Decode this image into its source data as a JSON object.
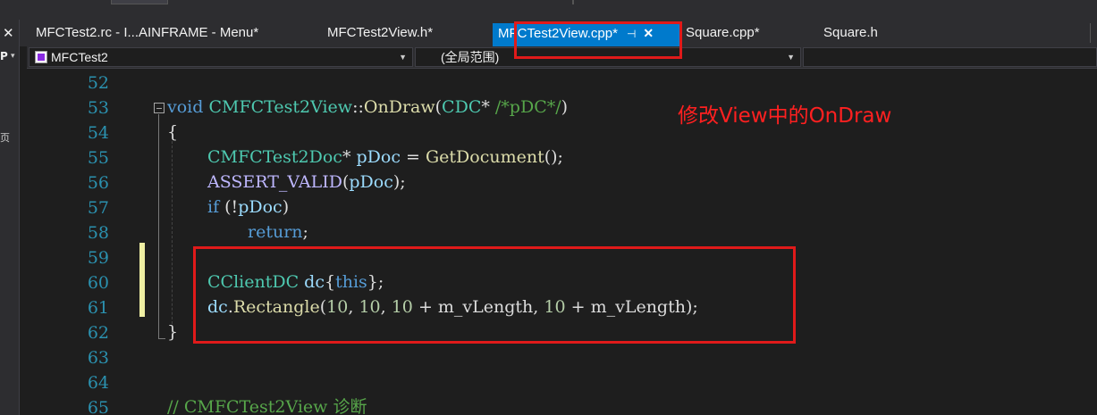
{
  "tabs": [
    {
      "label": "MFCTest2.rc - I...AINFRAME - Menu*",
      "active": false
    },
    {
      "label": "MFCTest2View.h*",
      "active": false
    },
    {
      "label": "MFCTest2View.cpp*",
      "active": true
    },
    {
      "label": "Square.cpp*",
      "active": false
    },
    {
      "label": "Square.h",
      "active": false
    }
  ],
  "tab_icons": {
    "pin": "pin-icon",
    "close": "close-icon"
  },
  "nav": {
    "project": "MFCTest2",
    "scope": "(全局范围)"
  },
  "line_numbers": [
    "52",
    "53",
    "54",
    "55",
    "56",
    "57",
    "58",
    "59",
    "60",
    "61",
    "62",
    "63",
    "64",
    "65"
  ],
  "annotation": {
    "text": "修改View中的OnDraw",
    "color": "#ff2020"
  },
  "colors": {
    "accent": "#007acc",
    "editor_bg": "#1e1e1e",
    "highlight_red": "#e01a1a",
    "line_number": "#2b91af"
  },
  "code": {
    "l53": {
      "kw": "void",
      "cls": "CMFCTest2View",
      "sep": "::",
      "fn": "OnDraw",
      "open": "(",
      "type": "CDC",
      "star": "* ",
      "cmt": "/*pDC*/",
      "close": ")"
    },
    "l54": "{",
    "l55": {
      "type": "CMFCTest2Doc",
      "star": "* ",
      "var": "pDoc",
      "eq": " = ",
      "fn": "GetDocument",
      "rest": "();"
    },
    "l56": {
      "macro": "ASSERT_VALID",
      "open": "(",
      "var": "pDoc",
      "rest": ");"
    },
    "l57": {
      "kw": "if",
      "mid": " (!",
      "var": "pDoc",
      "rest": ")"
    },
    "l58": {
      "kw": "return",
      "rest": ";"
    },
    "l60": {
      "type": "CClientDC",
      "sp": " ",
      "var": "dc",
      "open": "{",
      "kw": "this",
      "rest": "};"
    },
    "l61": {
      "var": "dc",
      "dot": ".",
      "fn": "Rectangle",
      "open": "(",
      "n1": "10",
      "c1": ", ",
      "n2": "10",
      "c2": ", ",
      "n3": "10",
      "plus1": " + ",
      "v1": "m_vLength",
      "c3": ", ",
      "n4": "10",
      "plus2": " + ",
      "v2": "m_vLength",
      "rest": ");"
    },
    "l62": "}",
    "l65": "// CMFCTest2View 诊断"
  }
}
